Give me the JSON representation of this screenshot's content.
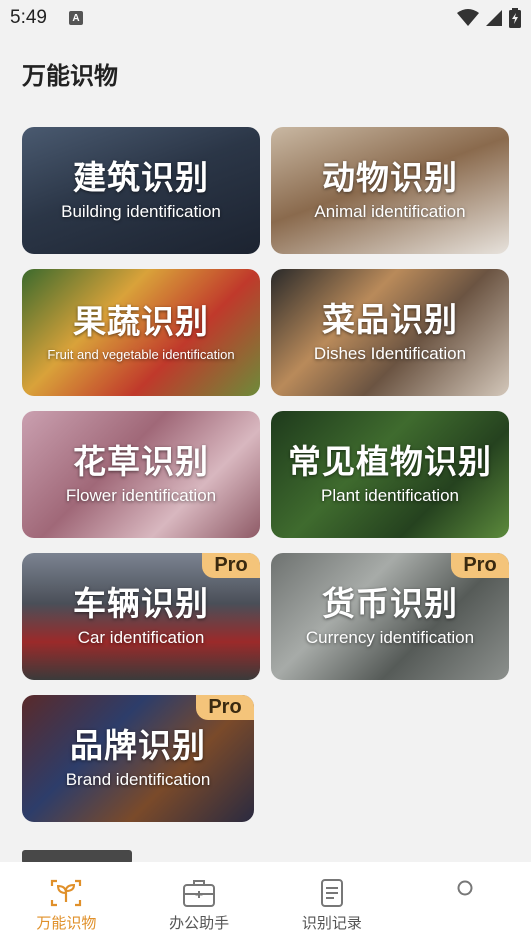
{
  "status_bar": {
    "time": "5:49",
    "notification_icon": "A"
  },
  "page_title": "万能识物",
  "cards": [
    {
      "cn": "建筑识别",
      "en": "Building identification",
      "pro": ""
    },
    {
      "cn": "动物识别",
      "en": "Animal identification",
      "pro": ""
    },
    {
      "cn": "果蔬识别",
      "en": "Fruit and vegetable identification",
      "pro": ""
    },
    {
      "cn": "菜品识别",
      "en": "Dishes Identification",
      "pro": ""
    },
    {
      "cn": "花草识别",
      "en": "Flower identification",
      "pro": ""
    },
    {
      "cn": "常见植物识别",
      "en": "Plant identification",
      "pro": ""
    },
    {
      "cn": "车辆识别",
      "en": "Car identification",
      "pro": "Pro"
    },
    {
      "cn": "货币识别",
      "en": "Currency identification",
      "pro": "Pro"
    },
    {
      "cn": "品牌识别",
      "en": "Brand identification",
      "pro": "Pro"
    }
  ],
  "bottom_nav": [
    {
      "label": "万能识物",
      "icon": "sprout-icon",
      "active": true
    },
    {
      "label": "办公助手",
      "icon": "briefcase-icon",
      "active": false
    },
    {
      "label": "识别记录",
      "icon": "document-icon",
      "active": false
    },
    {
      "label": "",
      "icon": "profile-icon",
      "active": false
    }
  ],
  "colors": {
    "accent": "#e0902a",
    "pro_badge": "#f4c47a",
    "background": "#f2f2f2"
  }
}
